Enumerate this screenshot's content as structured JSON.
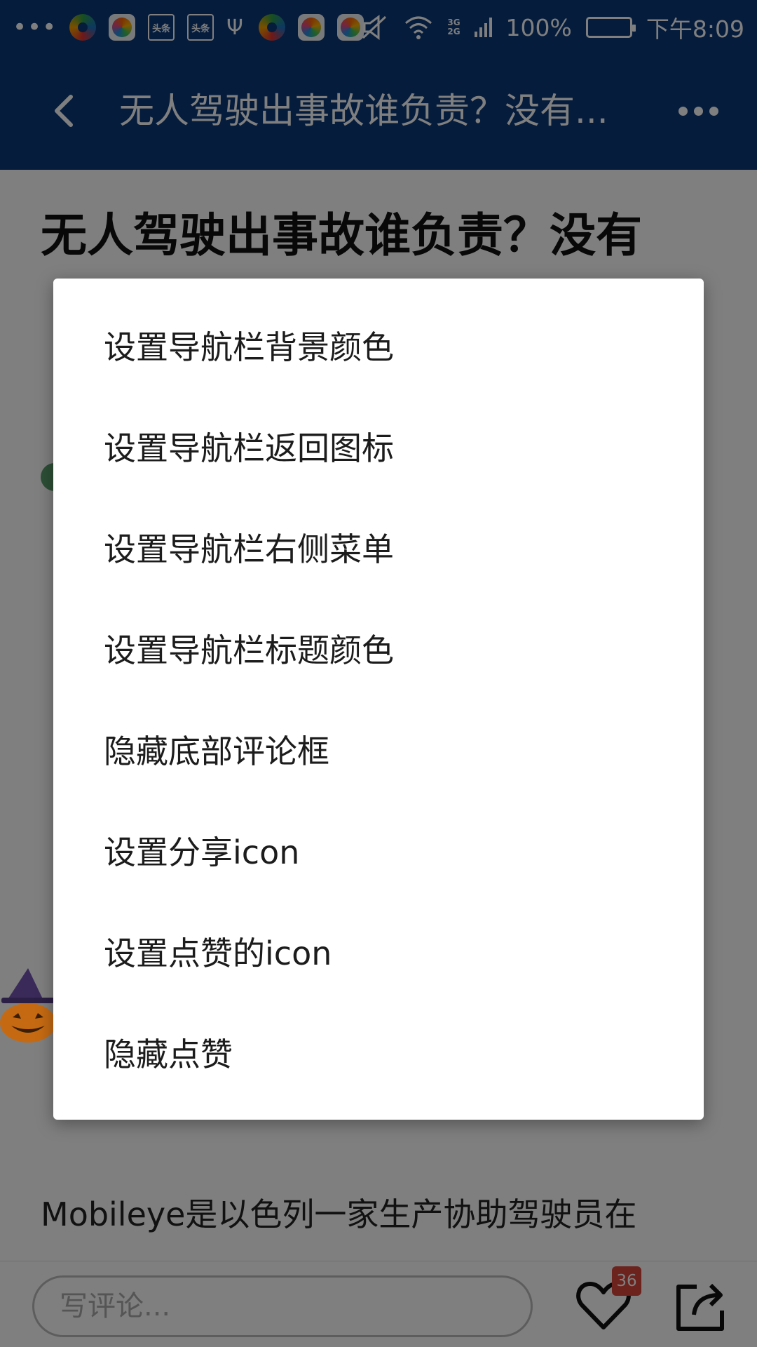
{
  "status_bar": {
    "battery_percent": "100%",
    "time": "下午8:09",
    "network_top": "3G",
    "network_bottom": "2G",
    "notification_app_label": "头条",
    "icons": [
      "more-dots-icon",
      "app360-icon",
      "game-ball-icon",
      "toutiao-icon",
      "toutiao-icon",
      "usb-icon",
      "app360-icon",
      "game-ball-icon",
      "game-ball-icon",
      "mute-icon",
      "wifi-icon",
      "signal-icon",
      "battery-icon"
    ]
  },
  "navbar": {
    "title": "无人驾驶出事故谁负责？没有..."
  },
  "article": {
    "title": "无人驾驶出事故谁负责？没有",
    "paragraph_2": "Mobileye是以色列一家生产协助驾驶员在"
  },
  "dialog": {
    "items": [
      "设置导航栏背景颜色",
      "设置导航栏返回图标",
      "设置导航栏右侧菜单",
      "设置导航栏标题颜色",
      "隐藏底部评论框",
      "设置分享icon",
      "设置点赞的icon",
      "隐藏点赞"
    ]
  },
  "bottom_bar": {
    "comment_placeholder": "写评论...",
    "like_count": "36"
  },
  "colors": {
    "nav_background": "#0a3978",
    "badge": "#d9443a"
  }
}
